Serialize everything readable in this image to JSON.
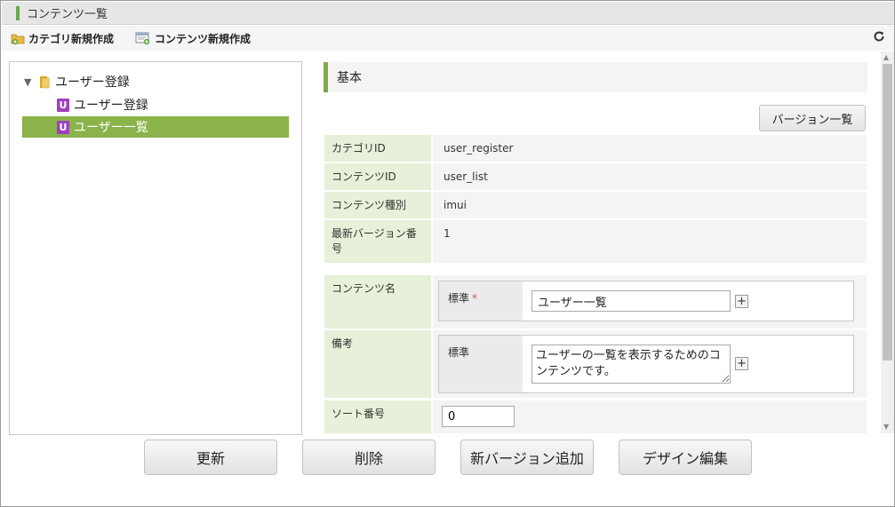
{
  "window": {
    "title": "コンテンツ一覧"
  },
  "toolbar": {
    "new_category": "カテゴリ新規作成",
    "new_content": "コンテンツ新規作成"
  },
  "tree": {
    "folder": "ユーザー登録",
    "items": [
      {
        "label": "ユーザー登録",
        "selected": false
      },
      {
        "label": "ユーザー一覧",
        "selected": true
      }
    ]
  },
  "detail": {
    "section_title": "基本",
    "version_button": "バージョン一覧",
    "fields": [
      {
        "label": "カテゴリID",
        "value": "user_register"
      },
      {
        "label": "コンテンツID",
        "value": "user_list"
      },
      {
        "label": "コンテンツ種別",
        "value": "imui"
      },
      {
        "label": "最新バージョン番号",
        "value": "1"
      }
    ],
    "content_name": {
      "label": "コンテンツ名",
      "locale": "標準",
      "required_mark": "*",
      "value": "ユーザー一覧"
    },
    "note": {
      "label": "備考",
      "locale": "標準",
      "value": "ユーザーの一覧を表示するためのコンテンツです。"
    },
    "sort": {
      "label": "ソート番号",
      "value": "0"
    }
  },
  "actions": {
    "update": "更新",
    "delete": "削除",
    "add_version": "新バージョン追加",
    "edit_design": "デザイン編集"
  },
  "colors": {
    "accent_green": "#8ab34a",
    "label_bg": "#e7f0d8",
    "u_icon": "#a040c0"
  }
}
